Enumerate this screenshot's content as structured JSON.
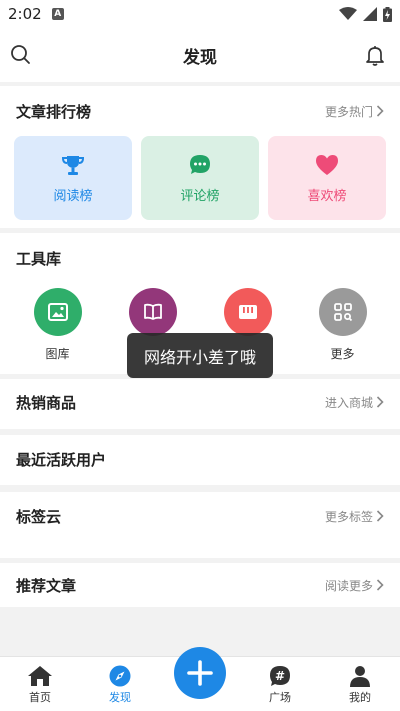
{
  "status": {
    "time": "2:02"
  },
  "header": {
    "title": "发现"
  },
  "ranking": {
    "title": "文章排行榜",
    "more": "更多热门",
    "cards": [
      {
        "label": "阅读榜",
        "icon": "trophy-icon",
        "bg": "#dceafc",
        "color": "#1e88e5"
      },
      {
        "label": "评论榜",
        "icon": "chat-bubble-icon",
        "bg": "#daf0e4",
        "color": "#21a366"
      },
      {
        "label": "喜欢榜",
        "icon": "heart-icon",
        "bg": "#fde3ea",
        "color": "#ee4b78"
      }
    ]
  },
  "tools": {
    "title": "工具库",
    "items": [
      {
        "label": "图库",
        "icon": "image-icon",
        "color": "#2fae6a"
      },
      {
        "label": "",
        "icon": "book-icon",
        "color": "#93377a"
      },
      {
        "label": "",
        "icon": "columns-icon",
        "color": "#f25a5a"
      },
      {
        "label": "更多",
        "icon": "grid-search-icon",
        "color": "#9a9a9a"
      }
    ]
  },
  "toast": "网络开小差了哦",
  "hot_goods": {
    "title": "热销商品",
    "more": "进入商城"
  },
  "active_users": {
    "title": "最近活跃用户"
  },
  "tag_cloud": {
    "title": "标签云",
    "more": "更多标签"
  },
  "recommend": {
    "title": "推荐文章",
    "more": "阅读更多"
  },
  "nav": {
    "items": [
      {
        "label": "首页",
        "icon": "home-icon"
      },
      {
        "label": "发现",
        "icon": "compass-icon"
      },
      {
        "label": "广场",
        "icon": "hashtag-chat-icon"
      },
      {
        "label": "我的",
        "icon": "user-icon"
      }
    ],
    "active": "发现"
  },
  "colors": {
    "accent": "#1e88e5"
  }
}
